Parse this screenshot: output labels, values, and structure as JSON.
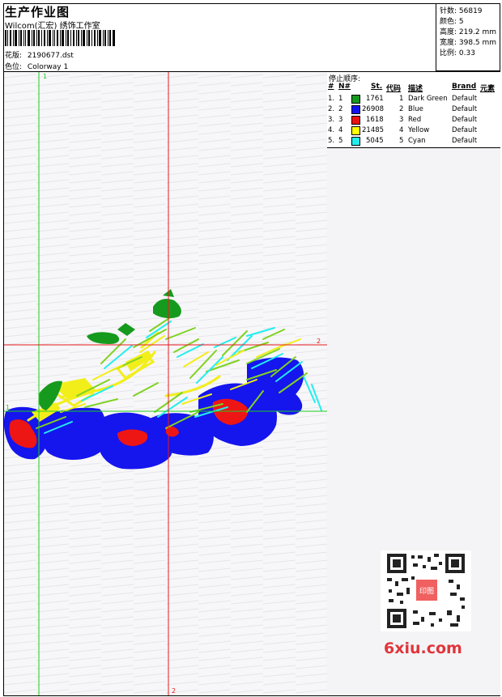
{
  "header": {
    "title": "生产作业图",
    "company": "Wilcom(汇宏) 绣饰工作室",
    "pattern_label": "花版:",
    "pattern_value": "2190677.dst",
    "color_label": "色位:",
    "color_value": "Colorway 1"
  },
  "stats": {
    "stitches": "针数: 56819",
    "colors": "颜色: 5",
    "height": "高度: 219.2 mm",
    "width": "宽度: 398.5 mm",
    "scale": "比例: 0.33"
  },
  "guides": {
    "top_marker": "1",
    "left_marker": "1",
    "right_marker": "2",
    "bottom_marker": "2"
  },
  "stop_sequence": {
    "title": "停止顺序:",
    "headers": [
      "#",
      "N#",
      "St.",
      "代码",
      "描述",
      "Brand",
      "元素"
    ],
    "rows": [
      {
        "idx": "1.",
        "n": "1",
        "color": "#169a1d",
        "st": "1761",
        "code": "1",
        "desc": "Dark Green",
        "brand": "Default"
      },
      {
        "idx": "2.",
        "n": "2",
        "color": "#1111ee",
        "st": "26908",
        "code": "2",
        "desc": "Blue",
        "brand": "Default"
      },
      {
        "idx": "3.",
        "n": "3",
        "color": "#ee1111",
        "st": "1618",
        "code": "3",
        "desc": "Red",
        "brand": "Default"
      },
      {
        "idx": "4.",
        "n": "4",
        "color": "#ffff00",
        "st": "21485",
        "code": "4",
        "desc": "Yellow",
        "brand": "Default"
      },
      {
        "idx": "5.",
        "n": "5",
        "color": "#22eeee",
        "st": "5045",
        "code": "5",
        "desc": "Cyan",
        "brand": "Default"
      }
    ]
  },
  "watermark": "6xiu.com",
  "qr_stamp": "印图"
}
